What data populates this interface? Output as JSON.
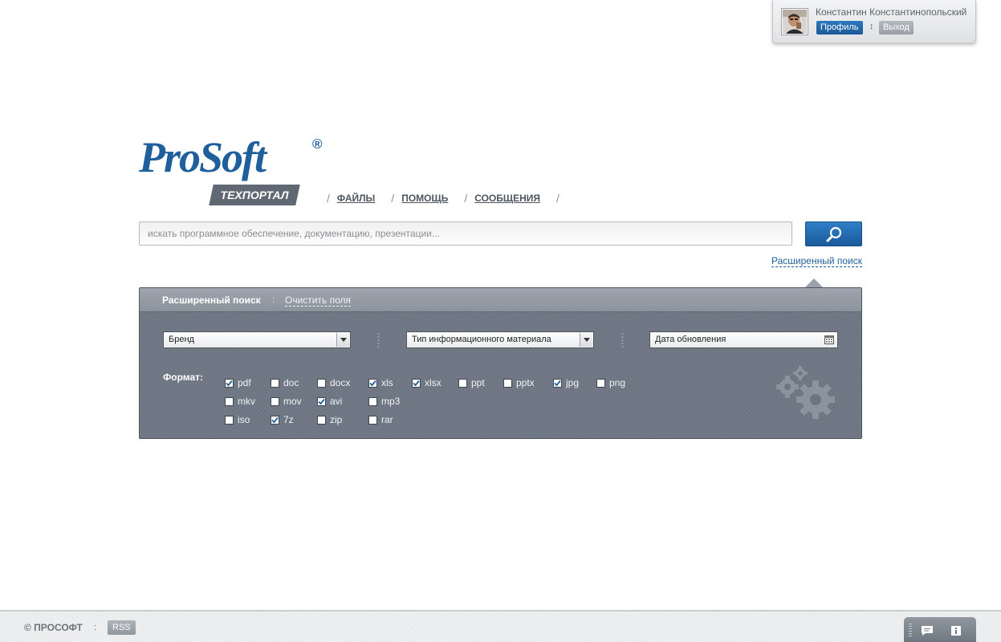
{
  "user": {
    "name": "Константин Константинопольский",
    "profile_label": "Профиль",
    "separator": "↕",
    "logout_label": "Выход"
  },
  "logo": {
    "brand": "ProSoft",
    "registered": "®",
    "subtitle": "ТЕХПОРТАЛ"
  },
  "nav": {
    "separator": "/",
    "items": [
      {
        "label": "ФАЙЛЫ"
      },
      {
        "label": "ПОМОЩЬ"
      },
      {
        "label": "СООБЩЕНИЯ"
      }
    ]
  },
  "search": {
    "placeholder": "искать программное обеспечение, документацию, презентации...",
    "value": "",
    "button_icon": "search-icon",
    "advanced_link": "Расширенный поиск"
  },
  "advanced": {
    "title": "Расширенный поиск",
    "separator": ":",
    "clear_label": "Очистить поля",
    "brand_select": "Бренд",
    "type_select": "Тип информационного материала",
    "date_select": "Дата обновления",
    "format_label": "Формат:",
    "formats": [
      {
        "label": "pdf",
        "checked": true
      },
      {
        "label": "doc",
        "checked": false
      },
      {
        "label": "docx",
        "checked": false
      },
      {
        "label": "xls",
        "checked": true
      },
      {
        "label": "xlsx",
        "checked": true
      },
      {
        "label": "ppt",
        "checked": false
      },
      {
        "label": "pptx",
        "checked": false
      },
      {
        "label": "jpg",
        "checked": true
      },
      {
        "label": "png",
        "checked": false
      },
      {
        "label": "mkv",
        "checked": false
      },
      {
        "label": "mov",
        "checked": false
      },
      {
        "label": "avi",
        "checked": true
      },
      {
        "label": "mp3",
        "checked": false
      },
      {
        "label": "iso",
        "checked": false
      },
      {
        "label": "7z",
        "checked": true
      },
      {
        "label": "zip",
        "checked": false
      },
      {
        "label": "rar",
        "checked": false
      }
    ]
  },
  "footer": {
    "copyright": "© ПРОСОФТ",
    "separator": ":",
    "rss_label": "RSS",
    "tools": [
      "chat-icon",
      "info-icon"
    ]
  },
  "colors": {
    "brand_blue": "#1f5f9b",
    "panel_bg": "#6c7581",
    "button_blue": "#2a74bb"
  }
}
